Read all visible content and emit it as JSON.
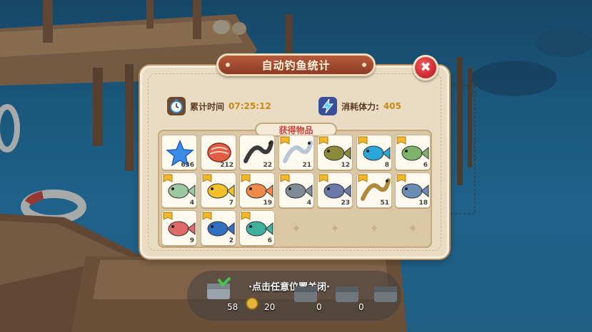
{
  "dialog": {
    "title": "自动钓鱼统计",
    "close_label": "✖",
    "time_label": "累计时间",
    "time_value": "07:25:12",
    "stamina_label": "消耗体力:",
    "stamina_value": "405",
    "items_header": "获得物品"
  },
  "items": [
    {
      "kind": "star",
      "color": "#3b8be8",
      "count": "636",
      "badge": false
    },
    {
      "kind": "steak",
      "color": "#e05c44",
      "count": "212",
      "badge": false
    },
    {
      "kind": "eel",
      "color": "#3a3a3a",
      "count": "22",
      "badge": false
    },
    {
      "kind": "eel",
      "color": "#b9c6d8",
      "count": "21",
      "badge": true
    },
    {
      "kind": "fish",
      "color": "#8a8a3a",
      "count": "12",
      "badge": true
    },
    {
      "kind": "fish",
      "color": "#2aa6d9",
      "count": "8",
      "badge": true
    },
    {
      "kind": "fish",
      "color": "#7fb26a",
      "count": "6",
      "badge": true
    },
    {
      "kind": "fish",
      "color": "#9cc9a0",
      "count": "4",
      "badge": true
    },
    {
      "kind": "fish",
      "color": "#f2c12a",
      "count": "7",
      "badge": true
    },
    {
      "kind": "fish",
      "color": "#f08a4a",
      "count": "19",
      "badge": true
    },
    {
      "kind": "fish",
      "color": "#7e8b97",
      "count": "4",
      "badge": true
    },
    {
      "kind": "fish",
      "color": "#6a7aa8",
      "count": "23",
      "badge": true
    },
    {
      "kind": "eel",
      "color": "#b08a3a",
      "count": "51",
      "badge": true
    },
    {
      "kind": "fish",
      "color": "#6b8cb5",
      "count": "18",
      "badge": true
    },
    {
      "kind": "fish",
      "color": "#e06a6a",
      "count": "9",
      "badge": true
    },
    {
      "kind": "fish",
      "color": "#2f6fc0",
      "count": "2",
      "badge": true
    },
    {
      "kind": "fish",
      "color": "#3fb0a0",
      "count": "6",
      "badge": true
    }
  ],
  "empty_slot_glyph": "✦",
  "footer": {
    "hint": "·点击任意位置关闭·",
    "rewards": [
      "58",
      "20",
      "0",
      "0"
    ]
  },
  "colors": {
    "accent_red": "#d2433d",
    "value_gold": "#c98a17",
    "panel": "#e9dcc3"
  }
}
